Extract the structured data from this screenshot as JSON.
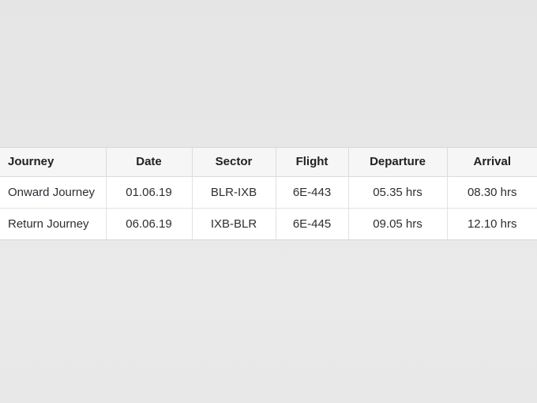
{
  "table": {
    "columns": [
      {
        "key": "journey",
        "label": "Journey",
        "align": "left"
      },
      {
        "key": "date",
        "label": "Date",
        "align": "center"
      },
      {
        "key": "sector",
        "label": "Sector",
        "align": "center"
      },
      {
        "key": "flight",
        "label": "Flight",
        "align": "center"
      },
      {
        "key": "departure",
        "label": "Departure",
        "align": "center"
      },
      {
        "key": "arrival",
        "label": "Arrival",
        "align": "center"
      }
    ],
    "rows": [
      {
        "journey": "Onward Journey",
        "date": "01.06.19",
        "sector": "BLR-IXB",
        "flight": "6E-443",
        "departure": "05.35 hrs",
        "arrival": "08.30 hrs"
      },
      {
        "journey": "Return Journey",
        "date": "06.06.19",
        "sector": "IXB-BLR",
        "flight": "6E-445",
        "departure": "09.05 hrs",
        "arrival": "12.10 hrs"
      }
    ]
  },
  "colors": {
    "page_background": "#e7e7e7",
    "table_background": "#ffffff",
    "header_background": "#f6f6f6",
    "header_text": "#212121",
    "body_text": "#2b2f36",
    "border": "#e2e2e2"
  }
}
